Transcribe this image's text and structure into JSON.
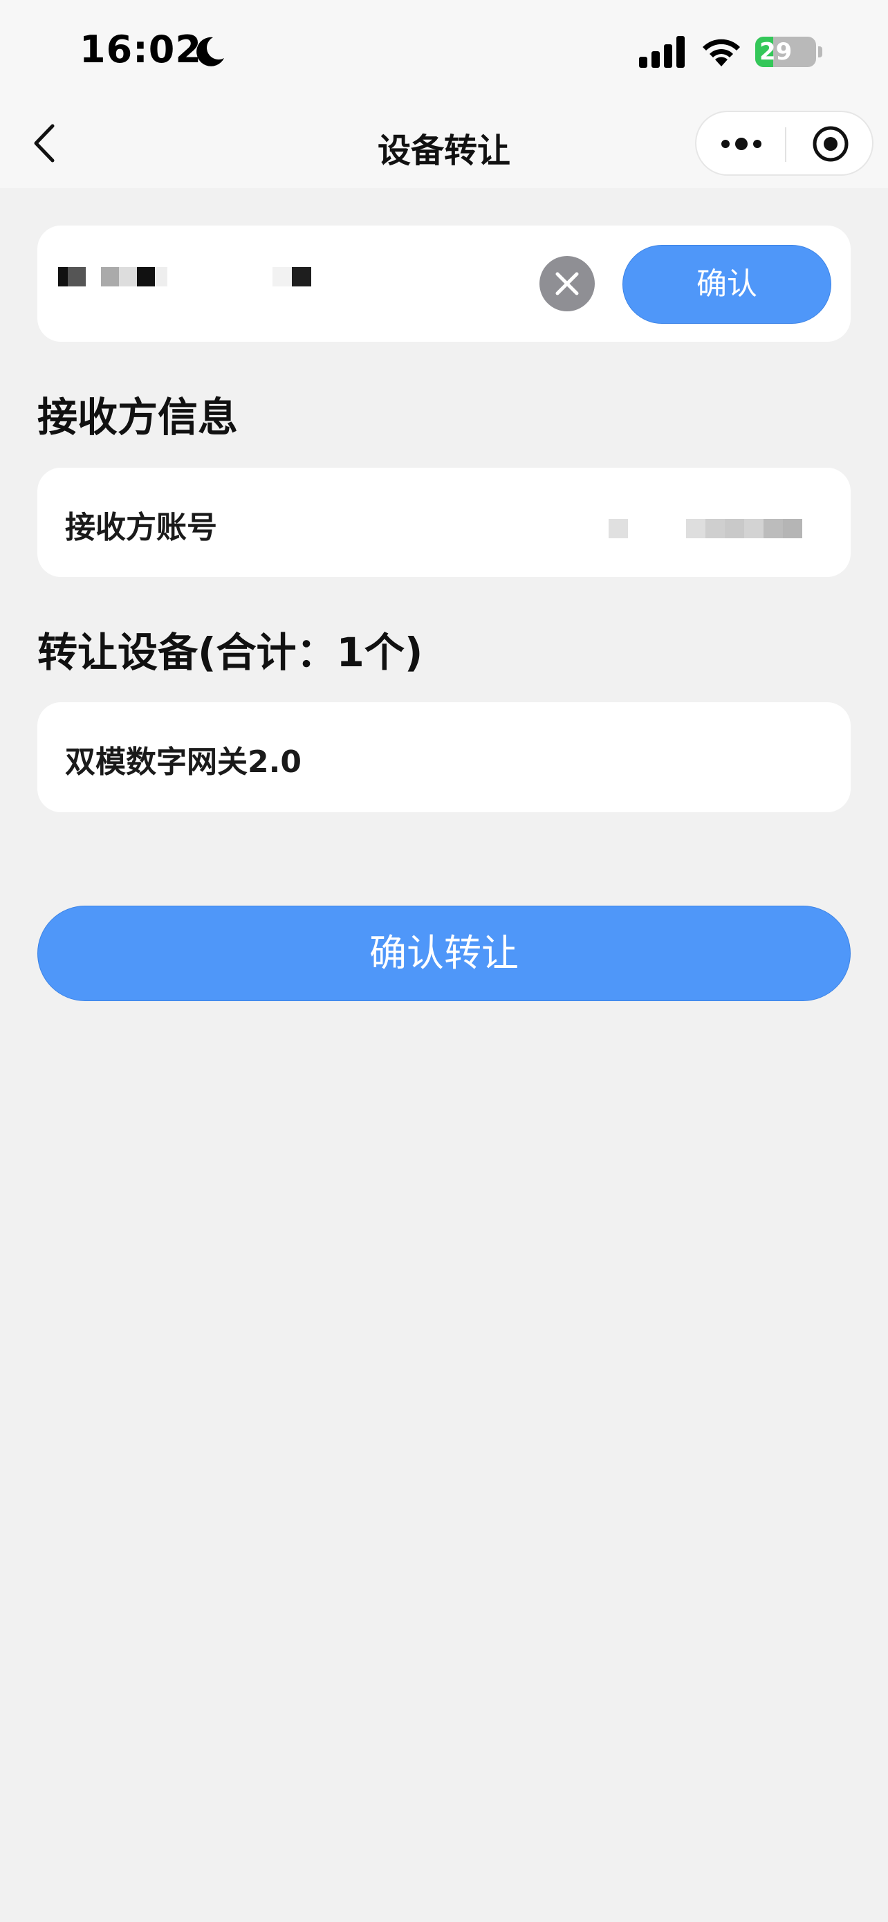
{
  "status_bar": {
    "time": "16:02",
    "battery_level": "29",
    "battery_fraction": 0.29,
    "icons": [
      "moon-icon",
      "signal-icon",
      "wifi-icon",
      "battery-charging-icon"
    ]
  },
  "nav": {
    "title": "设备转让",
    "icons": [
      "back-icon",
      "more-icon",
      "record-icon"
    ]
  },
  "search": {
    "value": "",
    "confirm_label": "确认",
    "clear_icon": "close-icon"
  },
  "receiver": {
    "section_title": "接收方信息",
    "account_label": "接收方账号",
    "account_value": ""
  },
  "devices": {
    "section_title": "转让设备(合计：1个)",
    "items": [
      {
        "name": "双模数字网关2.0"
      }
    ]
  },
  "actions": {
    "transfer_label": "确认转让"
  },
  "colors": {
    "primary": "#4f97f9",
    "background": "#f1f1f1",
    "battery_green": "#34c759"
  }
}
